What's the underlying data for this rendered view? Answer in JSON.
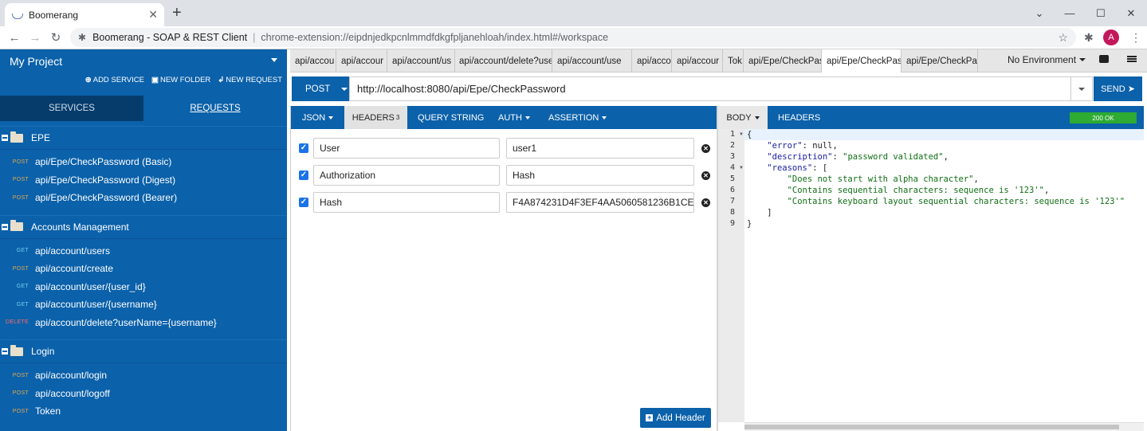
{
  "browser": {
    "tab_title": "Boomerang",
    "site_name": "Boomerang - SOAP & REST Client",
    "url": "chrome-extension://eipdnjedkpcnlmmdfdkgfpljanehloah/index.html#/workspace",
    "profile_initial": "A"
  },
  "sidebar": {
    "project_name": "My Project",
    "actions": {
      "add_service": "ADD SERVICE",
      "new_folder": "NEW FOLDER",
      "new_request": "NEW REQUEST"
    },
    "tabs": {
      "services": "SERVICES",
      "requests": "REQUESTS"
    },
    "groups": [
      {
        "name": "EPE",
        "items": [
          {
            "method": "POST",
            "name": "api/Epe/CheckPassword (Basic)"
          },
          {
            "method": "POST",
            "name": "api/Epe/CheckPassword (Digest)"
          },
          {
            "method": "POST",
            "name": "api/Epe/CheckPassword (Bearer)"
          }
        ]
      },
      {
        "name": "Accounts Management",
        "items": [
          {
            "method": "GET",
            "name": "api/account/users"
          },
          {
            "method": "POST",
            "name": "api/account/create"
          },
          {
            "method": "GET",
            "name": "api/account/user/{user_id}"
          },
          {
            "method": "GET",
            "name": "api/account/user/{username}"
          },
          {
            "method": "DELETE",
            "name": "api/account/delete?userName={username}"
          }
        ]
      },
      {
        "name": "Login",
        "items": [
          {
            "method": "POST",
            "name": "api/account/login"
          },
          {
            "method": "POST",
            "name": "api/account/logoff"
          },
          {
            "method": "POST",
            "name": "Token"
          }
        ]
      }
    ]
  },
  "request_tabs": [
    "api/accou",
    "api/accour",
    "api/account/us",
    "api/account/delete?use",
    "api/account/use",
    "api/accou",
    "api/accour",
    "Tok",
    "api/Epe/CheckPas",
    "api/Epe/CheckPas",
    "api/Epe/CheckPa"
  ],
  "environment": "No Environment",
  "request": {
    "method": "POST",
    "url": "http://localhost:8080/api/Epe/CheckPassword",
    "send_label": "SEND ➤",
    "tabs": {
      "json": "JSON",
      "headers": "HEADERS",
      "headers_count": "3",
      "query": "QUERY STRING",
      "auth": "AUTH",
      "assertion": "ASSERTION"
    },
    "headers": [
      {
        "key": "User",
        "value": "user1"
      },
      {
        "key": "Authorization",
        "value": "Hash"
      },
      {
        "key": "Hash",
        "value": "F4A874231D4F3EF4AA5060581236B1CE"
      }
    ],
    "add_header_label": "Add Header"
  },
  "response": {
    "tabs": {
      "body": "BODY",
      "headers": "HEADERS"
    },
    "status": "200 OK",
    "lines": [
      "{",
      "    \"error\": null,",
      "    \"description\": \"password validated\",",
      "    \"reasons\": [",
      "        \"Does not start with alpha character\",",
      "        \"Contains sequential characters: sequence is '123'\",",
      "        \"Contains keyboard layout sequential characters: sequence is '123'\"",
      "    ]",
      "}"
    ]
  },
  "colors": {
    "primary": "#0b61aa",
    "status_ok": "#2dab32"
  }
}
